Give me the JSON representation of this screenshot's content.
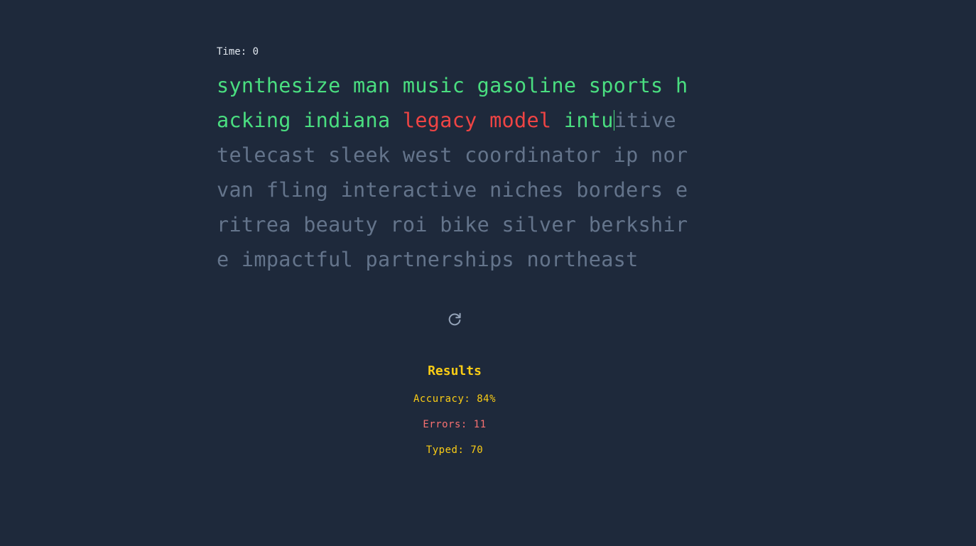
{
  "timer": {
    "label": "Time: 0"
  },
  "text": {
    "lines": [
      [
        {
          "text": "synthesize man music gasoline sports h",
          "state": "correct"
        }
      ],
      [
        {
          "text": "acking indiana ",
          "state": "correct"
        },
        {
          "text": "legacy model",
          "state": "error"
        },
        {
          "text": " intu",
          "state": "correct"
        },
        {
          "text": "",
          "state": "caret"
        },
        {
          "text": "itive",
          "state": "pending"
        }
      ],
      [
        {
          "text": "telecast sleek west coordinator ip nor",
          "state": "pending"
        }
      ],
      [
        {
          "text": "van fling interactive niches borders e",
          "state": "pending"
        }
      ],
      [
        {
          "text": "ritrea beauty roi bike silver berkshir",
          "state": "pending"
        }
      ],
      [
        {
          "text": "e impactful partnerships northeast",
          "state": "pending"
        }
      ]
    ]
  },
  "restart": {
    "icon": "restart-icon"
  },
  "results": {
    "title": "Results",
    "accuracy": "Accuracy: 84%",
    "errors": "Errors: 11",
    "typed": "Typed: 70"
  },
  "colors": {
    "background": "#1e293b",
    "correct": "#4ade80",
    "error": "#ef4444",
    "pending": "#64748b",
    "results": "#facc15",
    "errors_stat": "#f87171",
    "icon": "#94a3b8"
  }
}
